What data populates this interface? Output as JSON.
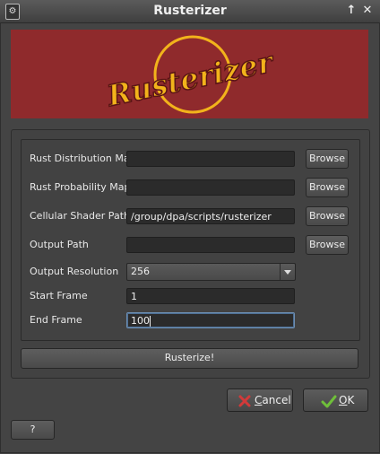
{
  "window": {
    "title": "Rusterizer",
    "maximize_glyph": "↑",
    "close_glyph": "✕"
  },
  "banner": {
    "logo_text": "Rusterizer",
    "background_color": "#8f2a2c",
    "logo_color": "#f2b31b"
  },
  "form": {
    "rust_distribution_map": {
      "label": "Rust Distribution Map",
      "value": "",
      "browse_label": "Browse"
    },
    "rust_probability_map": {
      "label": "Rust Probability Map",
      "value": "",
      "browse_label": "Browse"
    },
    "cellular_shader_path": {
      "label": "Cellular Shader Path",
      "value": "/group/dpa/scripts/rusterizer",
      "browse_label": "Browse"
    },
    "output_path": {
      "label": "Output Path",
      "value": "",
      "browse_label": "Browse"
    },
    "output_resolution": {
      "label": "Output Resolution",
      "value": "256"
    },
    "start_frame": {
      "label": "Start Frame",
      "value": "1"
    },
    "end_frame": {
      "label": "End Frame",
      "value": "100"
    }
  },
  "actions": {
    "rusterize_label": "Rusterize!",
    "cancel_label_first": "C",
    "cancel_label_rest": "ancel",
    "ok_label_first": "O",
    "ok_label_rest": "K",
    "help_label": "?"
  }
}
